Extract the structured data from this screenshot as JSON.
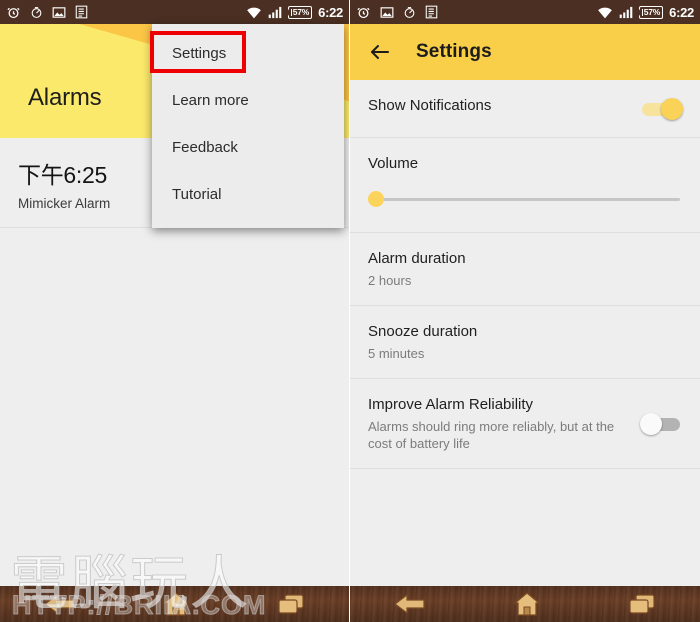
{
  "statusbar": {
    "left_icons_panel1": [
      "alarm-clock-icon",
      "timer-icon",
      "image-icon",
      "list-icon"
    ],
    "left_icons_panel2": [
      "alarm-clock-icon",
      "image-icon",
      "timer-icon",
      "list-icon"
    ],
    "wifi_icon": "wifi-icon",
    "signal_icon": "cellular-signal-icon",
    "battery_label": "57%",
    "time": "6:22",
    "bg_color": "#4a2f22"
  },
  "left_screen": {
    "header": {
      "title": "Alarms",
      "color_top": "#fbc546",
      "color_bottom": "#fae96b"
    },
    "alarm": {
      "time": "下午6:25",
      "name": "Mimicker Alarm",
      "enabled": true
    },
    "menu": {
      "items": [
        {
          "label": "Settings",
          "highlighted": true
        },
        {
          "label": "Learn more",
          "highlighted": false
        },
        {
          "label": "Feedback",
          "highlighted": false
        },
        {
          "label": "Tutorial",
          "highlighted": false
        }
      ],
      "highlight_color": "#ee0000"
    }
  },
  "right_screen": {
    "header": {
      "back_icon": "back-arrow-icon",
      "title": "Settings",
      "color": "#f9ce49"
    },
    "rows": [
      {
        "title": "Show Notifications",
        "subtitle": "",
        "control": "toggle",
        "value": "on"
      },
      {
        "title": "Volume",
        "subtitle": "",
        "control": "slider",
        "value": "0"
      },
      {
        "title": "Alarm duration",
        "subtitle": "2 hours",
        "control": "none",
        "value": ""
      },
      {
        "title": "Snooze duration",
        "subtitle": "5 minutes",
        "control": "none",
        "value": ""
      },
      {
        "title": "Improve Alarm Reliability",
        "subtitle": "Alarms should ring more reliably, but at the cost of battery life",
        "control": "toggle",
        "value": "off"
      }
    ]
  },
  "navbar": {
    "items": [
      "back-nav-icon",
      "home-nav-icon",
      "recents-nav-icon"
    ]
  },
  "watermark": {
    "chinese": "電腦玩人",
    "url": "HTTP://BRIIA.COM"
  }
}
